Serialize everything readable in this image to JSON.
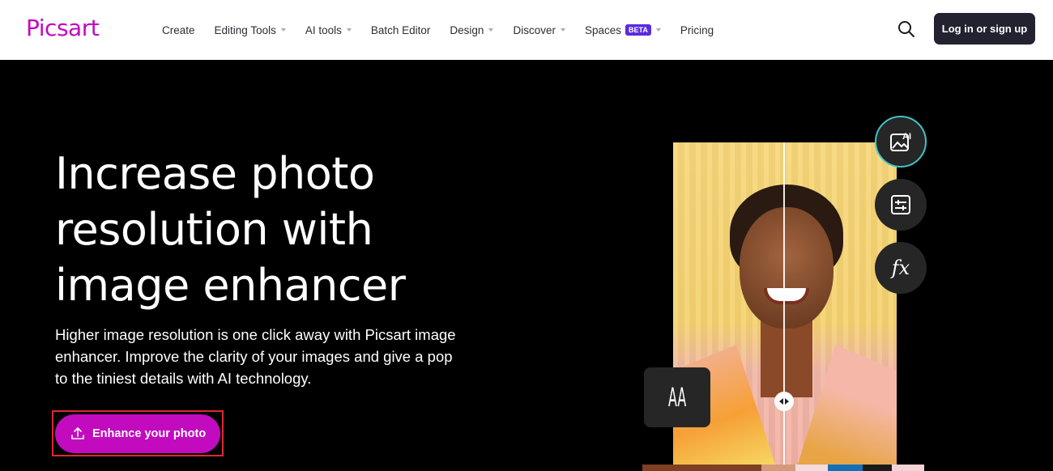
{
  "header": {
    "logo": "Picsart",
    "nav": [
      {
        "label": "Create",
        "dropdown": false
      },
      {
        "label": "Editing Tools",
        "dropdown": true
      },
      {
        "label": "AI tools",
        "dropdown": true
      },
      {
        "label": "Batch Editor",
        "dropdown": false
      },
      {
        "label": "Design",
        "dropdown": true
      },
      {
        "label": "Discover",
        "dropdown": true
      },
      {
        "label": "Spaces",
        "dropdown": true,
        "badge": "BETA"
      },
      {
        "label": "Pricing",
        "dropdown": false
      }
    ],
    "search_icon": "search-icon",
    "login_label": "Log in or sign up"
  },
  "hero": {
    "title_lines": [
      "Increase photo",
      "resolution with",
      "image enhancer"
    ],
    "description": "Higher image resolution is one click away with Picsart image enhancer. Improve the clarity of your images and give a pop to the tiniest details with AI technology.",
    "cta_label": "Enhance your photo",
    "cta_icon": "upload-icon"
  },
  "preview": {
    "font_card_text": "AA",
    "tools": [
      {
        "name": "ai-image-enhance",
        "icon": "ai-image-icon",
        "active": true
      },
      {
        "name": "adjust",
        "icon": "sliders-icon",
        "active": false
      },
      {
        "name": "effects",
        "icon": "fx-icon",
        "active": false,
        "label": "fx"
      }
    ],
    "palette": [
      "#7e3f22",
      "#d39a7c",
      "#f4dcdc",
      "#1270b8",
      "#1b1b1b",
      "#f2d4d4"
    ]
  },
  "colors": {
    "brand": "#c209c1",
    "cta": "#c20bbf",
    "beta": "#5a2ae0",
    "login_bg": "#222230",
    "highlight_outline": "#e0282e"
  }
}
